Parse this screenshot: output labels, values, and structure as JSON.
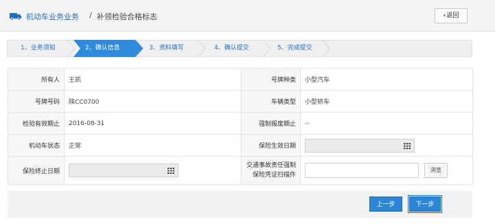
{
  "header": {
    "title": "机动车业务业务",
    "separator": "/",
    "subtitle": "补领检验合格标志",
    "back_label": "返回"
  },
  "steps": [
    {
      "label": "1、业务须知",
      "active": false
    },
    {
      "label": "2、确认信息",
      "active": true
    },
    {
      "label": "3、资料填写",
      "active": false
    },
    {
      "label": "4、确认提交",
      "active": false
    },
    {
      "label": "5、完成提交",
      "active": false
    }
  ],
  "form": {
    "owner_label": "所有人",
    "owner_value": "王凯",
    "plate_type_label": "号牌种类",
    "plate_type_value": "小型汽车",
    "plate_no_label": "号牌号码",
    "plate_no_value": "陕CC0700",
    "vehicle_type_label": "车辆类型",
    "vehicle_type_value": "小型轿车",
    "inspection_label": "检验有效期止",
    "inspection_value": "2016-08-31",
    "scrap_label": "强制报废期止",
    "scrap_value": "--",
    "status_label": "机动车状态",
    "status_value": "正常",
    "ins_start_label": "保险生效日期",
    "ins_end_label": "保险终止日期",
    "compulsory_label_1": "交通事故责任强制",
    "compulsory_label_2": "保险凭证扫描件",
    "browse_label": "浏览"
  },
  "footer": {
    "prev_label": "上一步",
    "next_label": "下一步"
  },
  "colors": {
    "accent": "#2c86d6",
    "step_active": "#2e8bdb",
    "link_blue": "#1f6fc1"
  },
  "icons": [
    "car-icon",
    "chevron-left-icon",
    "calendar-icon"
  ]
}
